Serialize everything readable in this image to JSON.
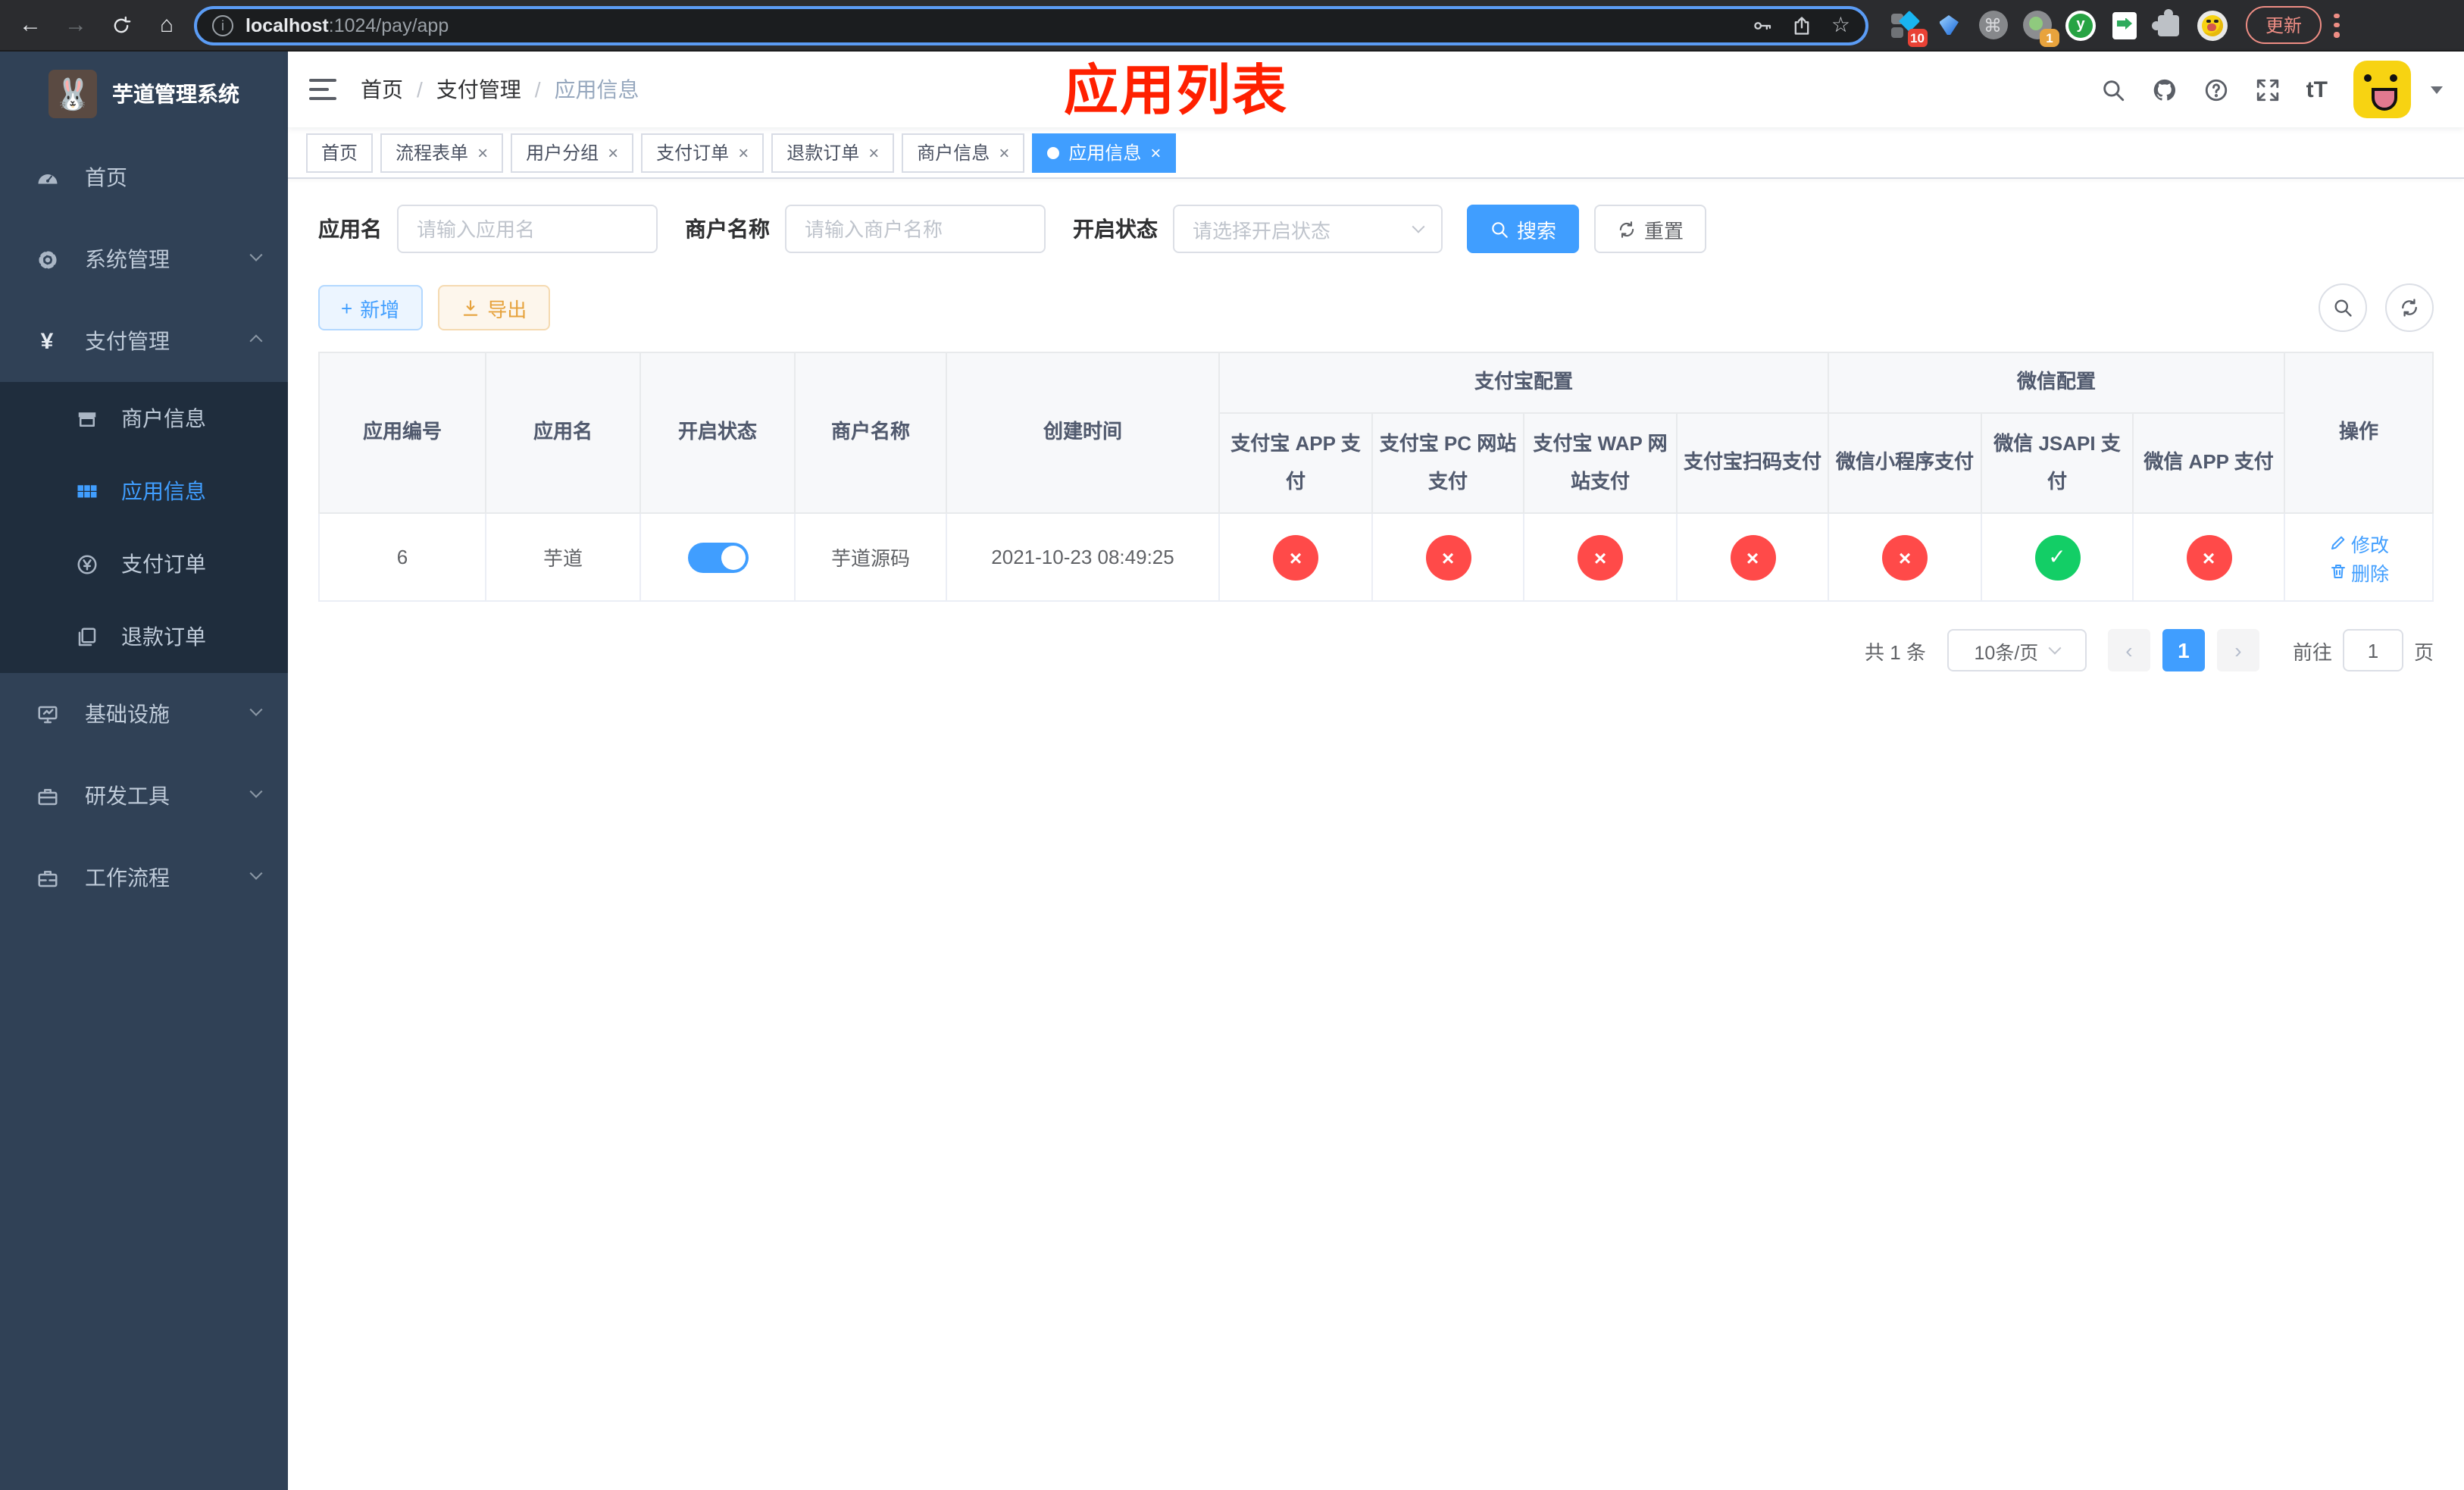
{
  "browser": {
    "url_host": "localhost",
    "url_path": ":1024/pay/app",
    "update_label": "更新",
    "ext_badge_pin": "10",
    "ext_badge_rec": "1",
    "ext_letter_y": "y"
  },
  "sidebar": {
    "title": "芋道管理系统",
    "menu": [
      {
        "label": "首页"
      },
      {
        "label": "系统管理"
      },
      {
        "label": "支付管理"
      },
      {
        "label": "基础设施"
      },
      {
        "label": "研发工具"
      },
      {
        "label": "工作流程"
      }
    ],
    "submenu": [
      {
        "label": "商户信息"
      },
      {
        "label": "应用信息"
      },
      {
        "label": "支付订单"
      },
      {
        "label": "退款订单"
      }
    ]
  },
  "navbar": {
    "breadcrumb": [
      "首页",
      "支付管理",
      "应用信息"
    ],
    "separator": "/",
    "overlay_title": "应用列表",
    "font_size_icon_text": "tT"
  },
  "tags": [
    {
      "label": "首页",
      "active": false,
      "closable": false
    },
    {
      "label": "流程表单",
      "active": false,
      "closable": true
    },
    {
      "label": "用户分组",
      "active": false,
      "closable": true
    },
    {
      "label": "支付订单",
      "active": false,
      "closable": true
    },
    {
      "label": "退款订单",
      "active": false,
      "closable": true
    },
    {
      "label": "商户信息",
      "active": false,
      "closable": true
    },
    {
      "label": "应用信息",
      "active": true,
      "closable": true
    }
  ],
  "close_glyph": "×",
  "filters": {
    "fields": [
      {
        "label": "应用名",
        "placeholder": "请输入应用名"
      },
      {
        "label": "商户名称",
        "placeholder": "请输入商户名称"
      },
      {
        "label": "开启状态",
        "placeholder": "请选择开启状态"
      }
    ],
    "search_label": "搜索",
    "reset_label": "重置"
  },
  "toolbar": {
    "add_label": "新增",
    "add_plus": "+",
    "export_label": "导出"
  },
  "table": {
    "simple_headers": [
      "应用编号",
      "应用名",
      "开启状态",
      "商户名称",
      "创建时间"
    ],
    "groups": [
      {
        "label": "支付宝配置"
      },
      {
        "label": "微信配置"
      }
    ],
    "channel_headers": [
      "支付宝 APP 支付",
      "支付宝 PC 网站支付",
      "支付宝 WAP 网站支付",
      "支付宝扫码支付",
      "微信小程序支付",
      "微信 JSAPI 支付",
      "微信 APP 支付"
    ],
    "action_header": "操作",
    "rows": [
      {
        "id": "6",
        "name": "芋道",
        "status": "on",
        "merchant": "芋道源码",
        "created": "2021-10-23 08:49:25",
        "channels": [
          {
            "state": "off",
            "glyph": "×"
          },
          {
            "state": "off",
            "glyph": "×"
          },
          {
            "state": "off",
            "glyph": "×"
          },
          {
            "state": "off",
            "glyph": "×"
          },
          {
            "state": "off",
            "glyph": "×"
          },
          {
            "state": "on",
            "glyph": "✓"
          },
          {
            "state": "off",
            "glyph": "×"
          }
        ],
        "actions": [
          {
            "label": "修改"
          },
          {
            "label": "删除"
          }
        ]
      }
    ]
  },
  "pagination": {
    "total": "共 1 条",
    "page_size": "10条/页",
    "prev_glyph": "‹",
    "next_glyph": "›",
    "current_page": "1",
    "goto_label": "前往",
    "goto_value": "1",
    "goto_suffix": "页"
  },
  "colors": {
    "primary": "#409eff",
    "success": "#13ce66",
    "danger": "#ff4a49",
    "warning": "#e6a23c",
    "annotation": "#ff2000",
    "sidebar_bg": "#304156",
    "submenu_bg": "#1f2d3d"
  }
}
